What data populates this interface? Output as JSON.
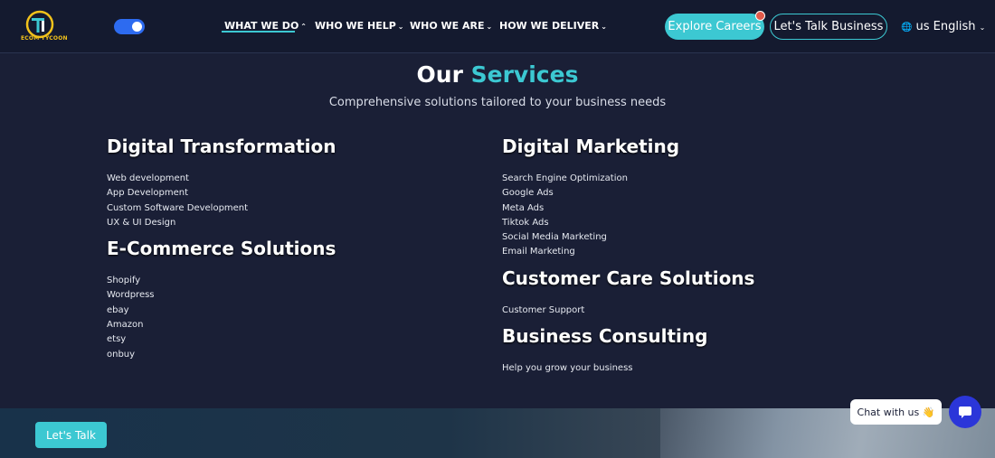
{
  "header": {
    "logo_text": "ECOM TYCOON",
    "nav": [
      {
        "label": "WHAT WE DO",
        "chevron": "⌃",
        "active": true
      },
      {
        "label": "WHO WE HELP",
        "chevron": "⌄"
      },
      {
        "label": "WHO WE ARE",
        "chevron": "⌄"
      },
      {
        "label": "HOW WE DELIVER",
        "chevron": "⌄"
      }
    ],
    "careers_label": "Explore Careers",
    "talk_business_label": "Let's Talk Business",
    "language": {
      "flag": "us",
      "label": "English"
    }
  },
  "services": {
    "title_prefix": "Our",
    "title_accent": "Services",
    "subtitle": "Comprehensive solutions tailored to your business needs",
    "left_groups": [
      {
        "title": "Digital Transformation",
        "items": [
          "Web development",
          "App Development",
          "Custom Software Development",
          "UX & UI Design"
        ]
      },
      {
        "title": "E-Commerce Solutions",
        "items": [
          "Shopify",
          "Wordpress",
          "ebay",
          "Amazon",
          "etsy",
          "onbuy"
        ]
      }
    ],
    "right_groups": [
      {
        "title": "Digital Marketing",
        "items": [
          "Search Engine Optimization",
          "Google Ads",
          "Meta Ads",
          "Tiktok Ads",
          "Social Media Marketing",
          "Email Marketing"
        ]
      },
      {
        "title": "Customer Care Solutions",
        "items": [
          "Customer Support"
        ]
      },
      {
        "title": "Business Consulting",
        "items": [
          "Help you grow your business"
        ]
      }
    ]
  },
  "footer": {
    "lets_talk_label": "Let's Talk",
    "chat_label": "Chat with us",
    "chat_emoji": "👋"
  },
  "colors": {
    "accent": "#3cc8d2",
    "background": "#1a1f36",
    "chat_button": "#2b36d9",
    "logo_yellow": "#f2c21b"
  }
}
